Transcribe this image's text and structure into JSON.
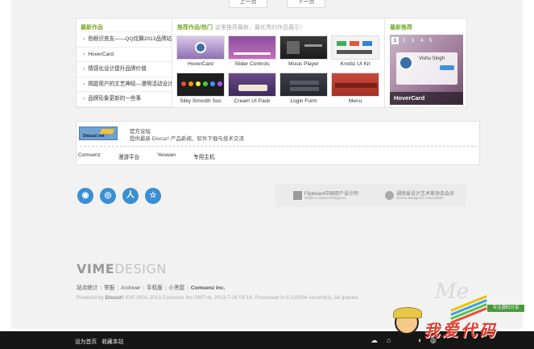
{
  "pager": {
    "prev": "上一页",
    "next": "下一页"
  },
  "latest": {
    "title": "最新作品",
    "items": [
      "色眼识良友——QQ炫舞2013品牌站",
      "HoverCard",
      "情感化设计提升品牌价值",
      "揭提用户的文艺神经—漫明活动设计小",
      "品牌形象更新的一些事"
    ]
  },
  "hot": {
    "title": "推荐作品/热门",
    "subtitle": "这里推荐最新，最优秀的作品展示！",
    "items": [
      {
        "caption": "HoverCard",
        "icon": "hovercard-thumb"
      },
      {
        "caption": "Slider Controls",
        "icon": "slider-controls-thumb"
      },
      {
        "caption": "Music Player",
        "icon": "music-player-thumb"
      },
      {
        "caption": "Knobz UI Kit",
        "icon": "knobz-ui-kit-thumb"
      },
      {
        "caption": "Silky Smooth Soc",
        "icon": "silky-smooth-thumb"
      },
      {
        "caption": "Cream UI Pack",
        "icon": "cream-ui-pack-thumb"
      },
      {
        "caption": "Login Form",
        "icon": "login-form-thumb"
      },
      {
        "caption": "Menu",
        "icon": "menu-thumb"
      }
    ]
  },
  "featured": {
    "title": "最新推荐",
    "tabs": [
      "1",
      "2",
      "3",
      "4",
      "5"
    ],
    "card_name": "Vishu Singh",
    "caption": "HoverCard"
  },
  "forum": {
    "logo_text": "Discuz!.net",
    "title": "官方论坛",
    "desc": "提供最新 Discuz! 产品新闻、软件下载与技术交流",
    "links": [
      "Comsenz",
      "漫游平台",
      "Yeswan",
      "专用主机"
    ]
  },
  "social": [
    {
      "icon": "weibo-icon",
      "glyph": "◉"
    },
    {
      "icon": "qzone-icon",
      "glyph": "◎"
    },
    {
      "icon": "renren-icon",
      "glyph": "人"
    },
    {
      "icon": "favorite-icon",
      "glyph": "☆"
    }
  ],
  "badges": [
    {
      "line1": "Flipboard中国用户设计师",
      "line2": "China Contract Designers"
    },
    {
      "line1": "湖南省设计艺术家协会会员",
      "line2": "Hunan Designers Association"
    }
  ],
  "footer": {
    "brand_bold": "VIME",
    "brand_light": "DESIGN",
    "links": [
      "站点统计",
      "举报",
      "Archiver",
      "手机版",
      "小黑屋"
    ],
    "company": "Comsenz Inc.",
    "powered_prefix": "Powered by ",
    "powered_name": "Discuz!",
    "powered_rest": " X3© 2001-2013 Comsenz Inc.GMT+8, 2013-7-26 09:14, Processed in 0.129304 second(s), 54 queries ."
  },
  "taskbar": {
    "left": [
      "设为首页",
      "收藏本站"
    ]
  },
  "watermark": {
    "tag": "专注源码分享",
    "text": "我爱代码"
  },
  "colors": {
    "accent_green": "#7aa82e",
    "social_blue": "#3a8fd4",
    "taskbar": "#161616"
  }
}
